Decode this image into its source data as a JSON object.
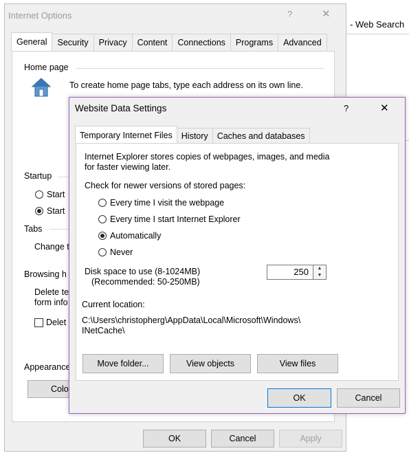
{
  "browser": {
    "background_text": "- Web Search"
  },
  "internet_options": {
    "title": "Internet Options",
    "help_glyph": "?",
    "close_glyph": "✕",
    "tabs": [
      "General",
      "Security",
      "Privacy",
      "Content",
      "Connections",
      "Programs",
      "Advanced"
    ],
    "active_tab": "General",
    "home_page_label": "Home page",
    "home_page_text": "To create home page tabs, type each address on its own line.",
    "startup_label": "Startup",
    "startup_options": [
      "Start",
      "Start"
    ],
    "tabs_label": "Tabs",
    "tabs_change_text": "Change t",
    "browsing_history_label": "Browsing h",
    "browsing_text_1": "Delete te",
    "browsing_text_2": "form info",
    "delete_checkbox_label": "Delet",
    "appearance_label": "Appearance",
    "colors_button": "Colo",
    "ok_button": "OK",
    "cancel_button": "Cancel",
    "apply_button": "Apply"
  },
  "website_data_settings": {
    "title": "Website Data Settings",
    "help_glyph": "?",
    "close_glyph": "✕",
    "tabs": [
      "Temporary Internet Files",
      "History",
      "Caches and databases"
    ],
    "active_tab": "Temporary Internet Files",
    "description_line1": "Internet Explorer stores copies of webpages, images, and media",
    "description_line2": "for faster viewing later.",
    "check_label": "Check for newer versions of stored pages:",
    "options": [
      {
        "label": "Every time I visit the webpage",
        "selected": false
      },
      {
        "label": "Every time I start Internet Explorer",
        "selected": false
      },
      {
        "label": "Automatically",
        "selected": true
      },
      {
        "label": "Never",
        "selected": false
      }
    ],
    "disk_space_label": "Disk space to use (8-1024MB)",
    "disk_space_recommended": "(Recommended: 50-250MB)",
    "disk_space_value": "250",
    "current_location_label": "Current location:",
    "current_location_line1": "C:\\Users\\christopherg\\AppData\\Local\\Microsoft\\Windows\\",
    "current_location_line2": "INetCache\\",
    "move_folder_button": "Move folder...",
    "view_objects_button": "View objects",
    "view_files_button": "View files",
    "ok_button": "OK",
    "cancel_button": "Cancel"
  },
  "colors": {
    "dialog_border": "#9b64b9",
    "ok_focus": "#0078d7"
  }
}
